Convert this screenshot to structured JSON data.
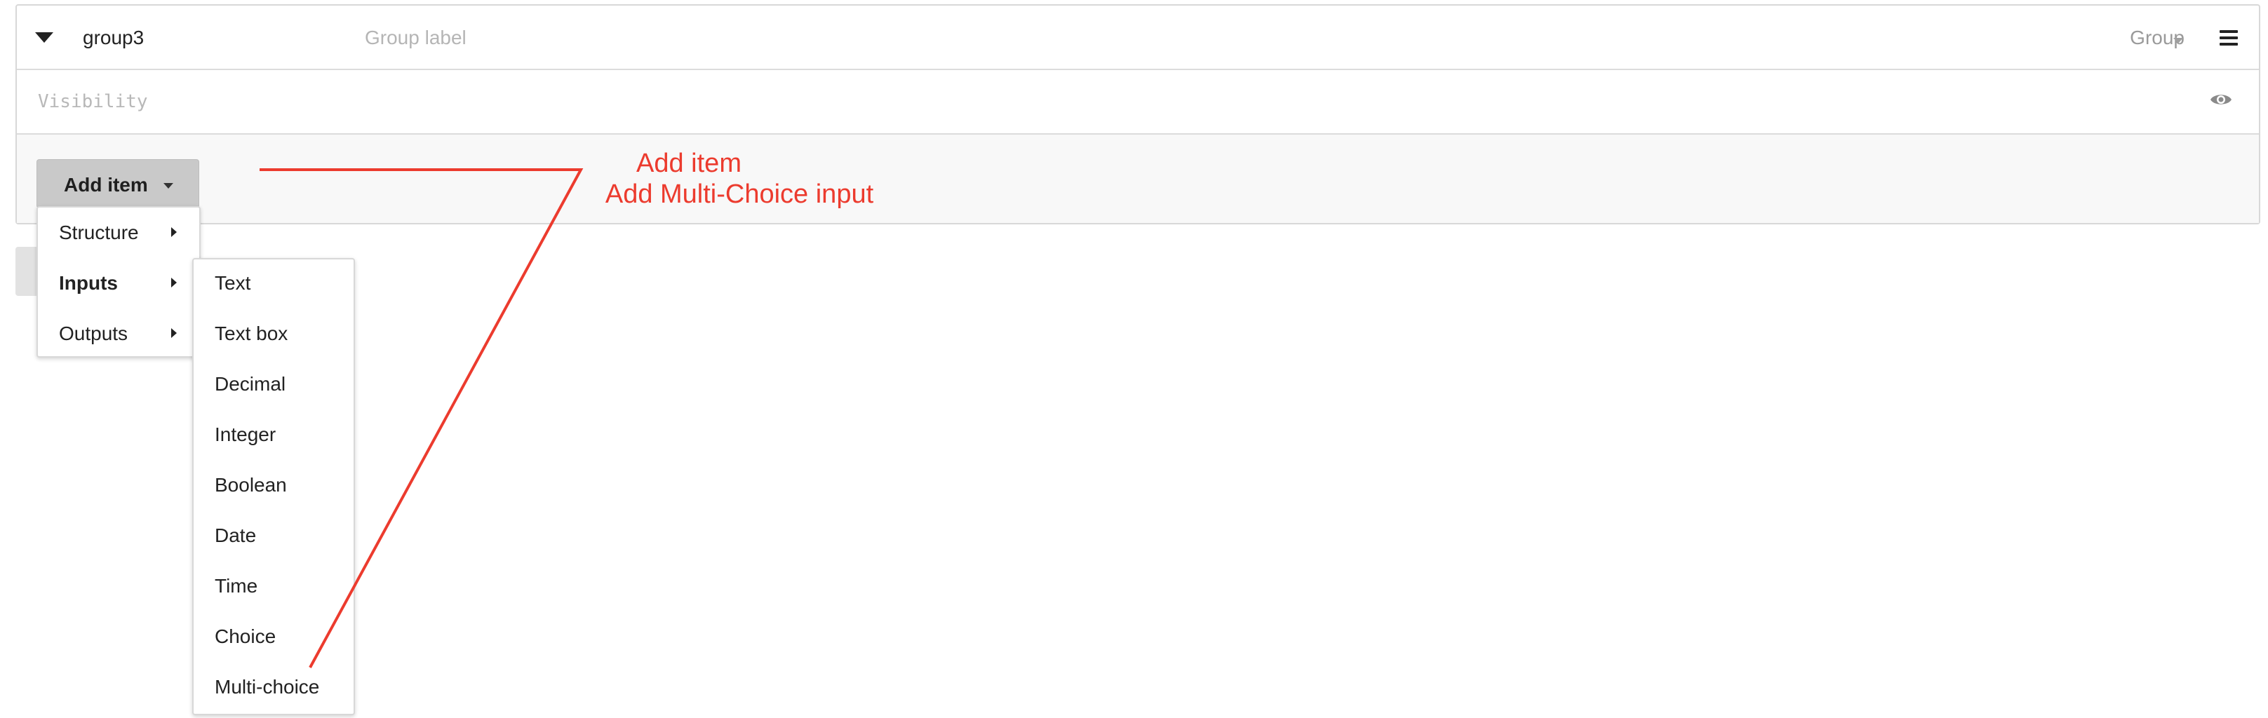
{
  "group": {
    "name": "group3",
    "label_placeholder": "Group label",
    "type": "Group"
  },
  "visibility": {
    "placeholder": "Visibility"
  },
  "add_item": {
    "label": "Add item"
  },
  "menu": {
    "items": [
      {
        "label": "Structure"
      },
      {
        "label": "Inputs"
      },
      {
        "label": "Outputs"
      }
    ],
    "active": "Inputs"
  },
  "inputs_submenu": {
    "items": [
      {
        "label": "Text"
      },
      {
        "label": "Text box"
      },
      {
        "label": "Decimal"
      },
      {
        "label": "Integer"
      },
      {
        "label": "Boolean"
      },
      {
        "label": "Date"
      },
      {
        "label": "Time"
      },
      {
        "label": "Choice"
      },
      {
        "label": "Multi-choice"
      }
    ]
  },
  "annotation": {
    "line1": "Add item",
    "line2": "Add Multi-Choice input",
    "color": "#ec3b2e"
  }
}
